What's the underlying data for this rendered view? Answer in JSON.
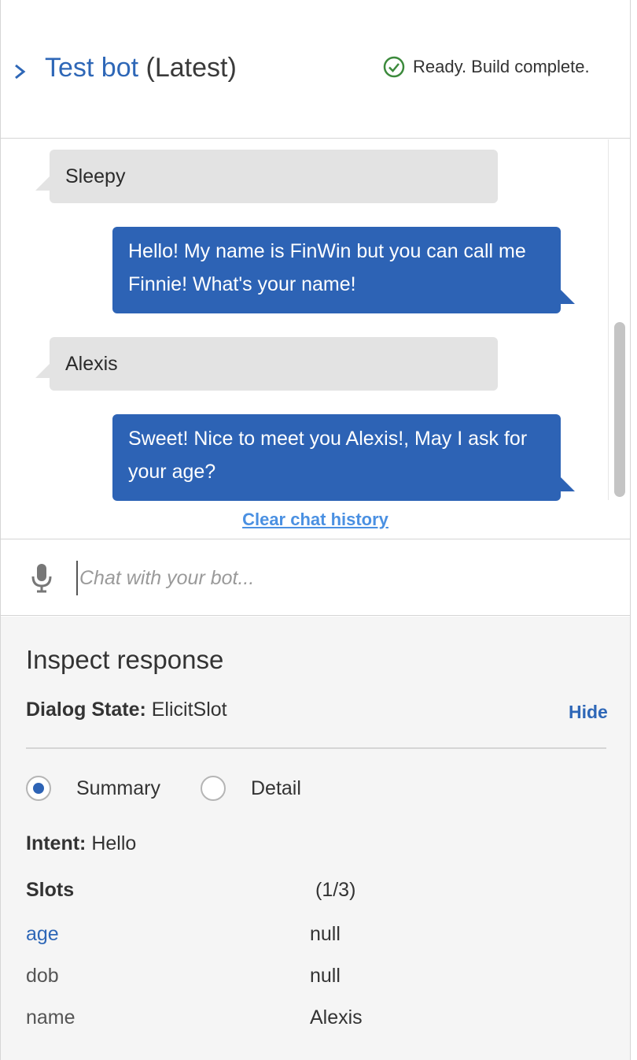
{
  "header": {
    "title_name": "Test bot",
    "title_version": "(Latest)",
    "status_text": "Ready. Build complete.",
    "status_color": "#3c8a3c"
  },
  "chat": {
    "messages": [
      {
        "sender": "user",
        "text": "Sleepy"
      },
      {
        "sender": "bot",
        "text": "Hello! My name is FinWin but you can call me Finnie! What's your name!"
      },
      {
        "sender": "user",
        "text": "Alexis"
      },
      {
        "sender": "bot",
        "text": "Sweet! Nice to meet you Alexis!, May I ask for your age?"
      }
    ],
    "clear_label": "Clear chat history"
  },
  "input": {
    "placeholder": "Chat with your bot...",
    "mic_icon": "microphone-icon"
  },
  "inspect": {
    "title": "Inspect response",
    "dialog_state_label": "Dialog State:",
    "dialog_state_value": "ElicitSlot",
    "hide_label": "Hide",
    "view_options": [
      {
        "label": "Summary",
        "selected": true
      },
      {
        "label": "Detail",
        "selected": false
      }
    ],
    "intent_label": "Intent:",
    "intent_value": "Hello",
    "slots_label": "Slots",
    "slots_count": "(1/3)",
    "slots": [
      {
        "name": "age",
        "value": "null"
      },
      {
        "name": "dob",
        "value": "null"
      },
      {
        "name": "name",
        "value": "Alexis"
      }
    ]
  },
  "colors": {
    "accent": "#2e67b7",
    "bot_bubble": "#2d63b5",
    "user_bubble": "#e3e3e3",
    "link": "#4a90e2"
  }
}
